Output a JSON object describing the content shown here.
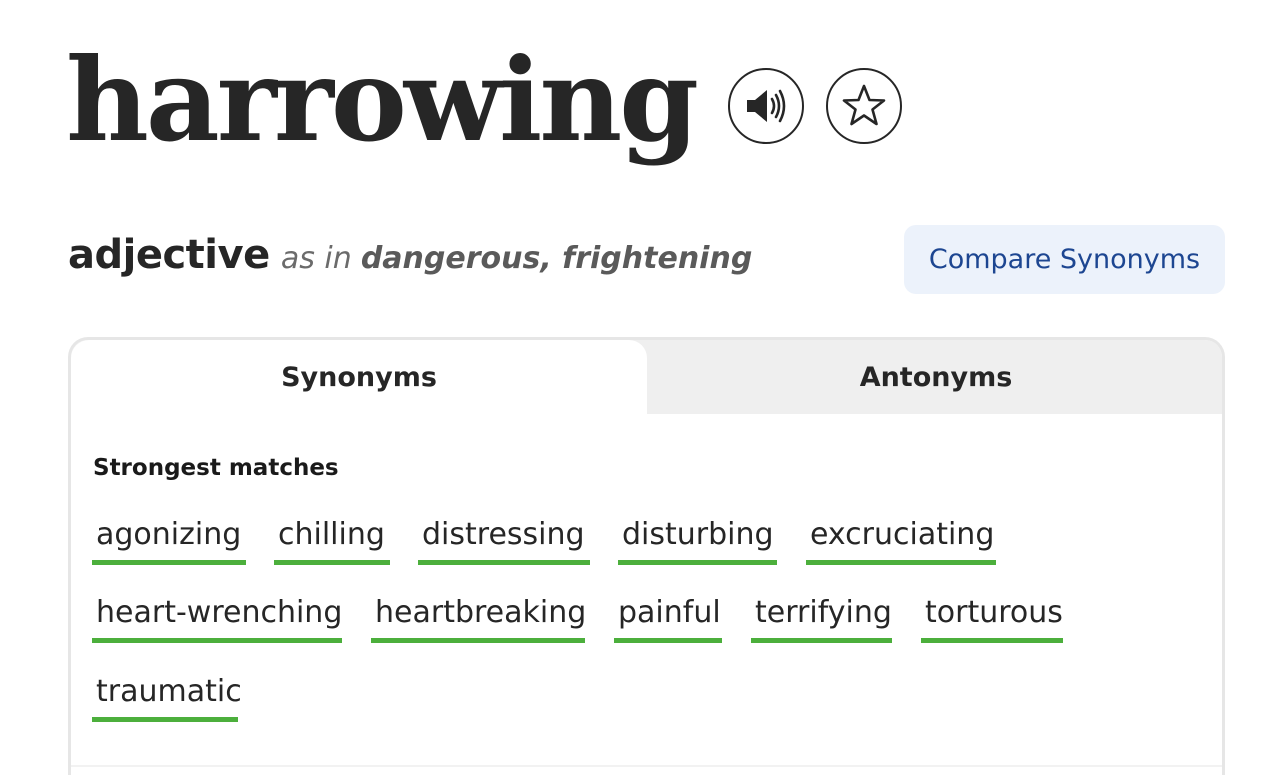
{
  "entry": {
    "headword": "harrowing",
    "audio_icon": "speaker-icon",
    "favorite_icon": "star-icon"
  },
  "sense": {
    "part_of_speech": "adjective",
    "as_in_label": "as in",
    "meaning": "dangerous, frightening"
  },
  "compare_button": {
    "label": "Compare Synonyms",
    "color": "#1d4691",
    "background": "#ecf2fb"
  },
  "tabs": [
    {
      "label": "Synonyms",
      "active": true
    },
    {
      "label": "Antonyms",
      "active": false
    }
  ],
  "matches": {
    "heading": "Strongest matches",
    "underline_color": "#4caf3c",
    "words": [
      "agonizing",
      "chilling",
      "distressing",
      "disturbing",
      "excruciating",
      "heart-wrenching",
      "heartbreaking",
      "painful",
      "terrifying",
      "torturous",
      "traumatic"
    ]
  }
}
